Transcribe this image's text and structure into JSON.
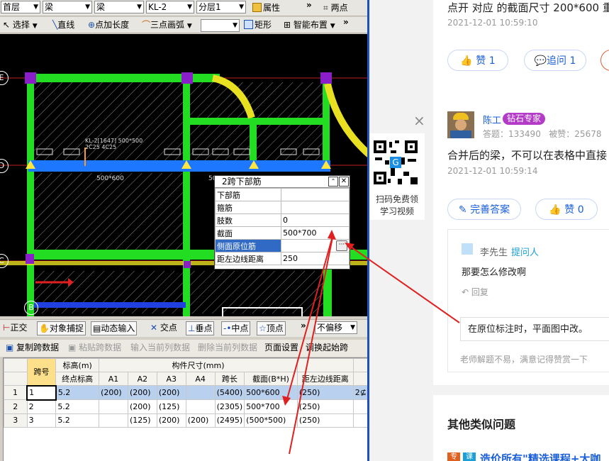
{
  "app": {
    "toolbar1": {
      "floor": "首层",
      "category1": "梁",
      "category2": "梁",
      "component": "KL-2",
      "layer": "分层1",
      "properties": "属性",
      "more": "»",
      "two_points": "两点"
    },
    "toolbar2": {
      "select": "选择",
      "line": "直线",
      "point_length": "点加长度",
      "three_point_arc": "三点画弧",
      "rect": "矩形",
      "smart_layout": "智能布置",
      "more": "»"
    },
    "canvas": {
      "axes": [
        "E",
        "D",
        "C",
        "B"
      ],
      "beam_label_1": "KL-2[1647] 500*500",
      "beam_label_2": "2C25 4C25",
      "dim_label_1": "500*600",
      "dim_label_2": "50"
    },
    "popup": {
      "title": "2跨下部筋",
      "rows": [
        {
          "label": "下部筋",
          "value": ""
        },
        {
          "label": "箍筋",
          "value": ""
        },
        {
          "label": "肢数",
          "value": "0"
        },
        {
          "label": "截面",
          "value": "500*700"
        },
        {
          "label": "侧面原位筋",
          "value": ""
        },
        {
          "label": "距左边线距离",
          "value": "250"
        }
      ]
    },
    "snapbar": {
      "ortho": "正交",
      "obj_snap": "对象捕捉",
      "dynamic_input": "动态输入",
      "intersection": "交点",
      "perpendicular": "垂点",
      "midpoint": "中点",
      "vertex": "顶点",
      "more": "»",
      "no_offset": "不偏移"
    },
    "grid_toolbar": {
      "copy_span": "复制跨数据",
      "paste_span": "粘贴跨数据",
      "input_col": "输入当前列数据",
      "delete_col": "删除当前列数据",
      "page_setup": "页面设置",
      "adjust_start": "调换起始跨"
    },
    "grid": {
      "header_top": [
        "跨号",
        "标高(m)",
        "构件尺寸(mm)"
      ],
      "header_cols": [
        "",
        "终点标高",
        "A1",
        "A2",
        "A3",
        "A4",
        "跨长",
        "截面(B*H)",
        "距左边线距离"
      ],
      "rows": [
        [
          "1",
          "1",
          "5.2",
          "(200)",
          "(200)",
          "(200)",
          "",
          "(5400)",
          "500*600",
          "(250)",
          "2⊈"
        ],
        [
          "2",
          "2",
          "5.2",
          "",
          "(200)",
          "(125)",
          "",
          "(2305)",
          "500*700",
          "(250)",
          ""
        ],
        [
          "3",
          "3",
          "5.2",
          "",
          "(125)",
          "(200)",
          "(200)",
          "(2495)",
          "(500*500)",
          "(250)",
          ""
        ]
      ]
    }
  },
  "web": {
    "top_text": "点开 对应 的截面尺寸 200*600 重",
    "time1": "2021-12-01 10:59:10",
    "like1": "赞 1",
    "followup1": "追问 1",
    "close_icon": "×",
    "qr_caption_1": "扫码免费领",
    "qr_caption_2": "学习视频",
    "user_name": "陈工",
    "badge": "钻石专家",
    "stats_answers": "答题：",
    "answers_count": "133490",
    "stats_liked": "被赞：",
    "liked_count": "25678",
    "answer_text": "合并后的梁，不可以在表格中直接",
    "time2": "2021-12-01 10:59:14",
    "improve": "完善答案",
    "like2": "赞 0",
    "asker_name": "李先生",
    "asker_tag": "提问人",
    "question": "那要怎么修改啊",
    "reply": "回复",
    "reply_box": "在原位标注时，平面图中改。",
    "thanks": "老师解题不易，满意记得赞赏一下",
    "similar_title": "其他类似问题",
    "ad_text": "造价所有\"精选课程+大咖"
  },
  "colors": {
    "accent_blue": "#1a5fd8",
    "annotation_red": "#e02020",
    "beam_green": "#22dd22",
    "beam_blue": "#1e78ff"
  }
}
